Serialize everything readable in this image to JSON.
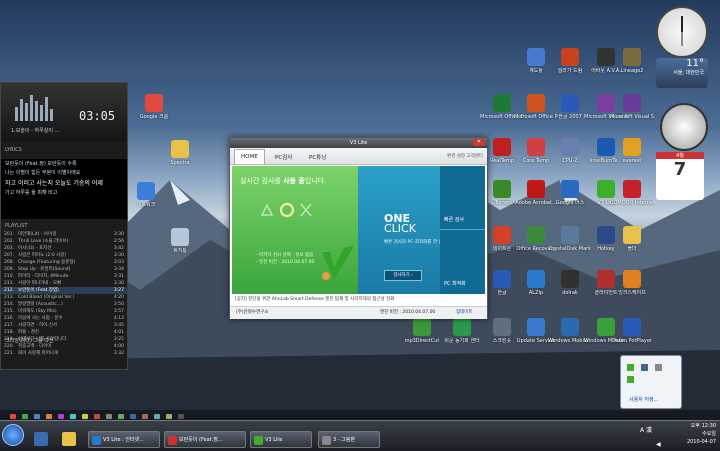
{
  "desktop": {
    "icons_left": [
      {
        "label": "Google 크롬",
        "color": "#e34a3d"
      },
      {
        "label": "Spectra",
        "color": "#e8c14a"
      },
      {
        "label": "네트워크",
        "color": "#3c7fd8"
      },
      {
        "label": "휴지통",
        "color": "#b8c7d8"
      }
    ],
    "icons_grid": [
      {
        "label": "계도툴",
        "color": "#4a7ad0"
      },
      {
        "label": "릴라가 드림",
        "color": "#c7421f"
      },
      {
        "label": "어바웃 A.V.A.",
        "color": "#333333"
      },
      {
        "label": "Lineage2",
        "color": "#7b6c3f"
      },
      {
        "label": "Microsoft Office Ex...",
        "color": "#1f7a3a"
      },
      {
        "label": "Microsoft Office Po...",
        "color": "#d0531d"
      },
      {
        "label": "한글 2007",
        "color": "#2d5ab8"
      },
      {
        "label": "Microsoft Visual Ba...",
        "color": "#7a3fa0"
      },
      {
        "label": "Microsoft Visual Stud...",
        "color": "#6a3a9a"
      },
      {
        "label": "RealTemp",
        "color": "#c02020"
      },
      {
        "label": "Core Temp",
        "color": "#d04040"
      },
      {
        "label": "CPU-Z",
        "color": "#6a7fb0"
      },
      {
        "label": "IntelBurnTe...",
        "color": "#1a5ab0"
      },
      {
        "label": "everest",
        "color": "#e0a020"
      },
      {
        "label": "uTorrent",
        "color": "#3a8a2a"
      },
      {
        "label": "Adobe Acrobat...",
        "color": "#c01818"
      },
      {
        "label": "Google 어스",
        "color": "#2a6ac0"
      },
      {
        "label": "V3 Lite",
        "color": "#3fae2a"
      },
      {
        "label": "COMODO Internet...",
        "color": "#c8202a"
      },
      {
        "label": "네이트온",
        "color": "#d4402a"
      },
      {
        "label": "Office Recovery",
        "color": "#3a8a3a"
      },
      {
        "label": "CrystalDisk Mark",
        "color": "#5a7aa0"
      },
      {
        "label": "Hotkey",
        "color": "#2a4a8a"
      },
      {
        "label": "폴더",
        "color": "#e8c14a"
      },
      {
        "label": "한글",
        "color": "#2a5ab8"
      },
      {
        "label": "ALZip",
        "color": "#2a7ad0"
      },
      {
        "label": "dolrak",
        "color": "#303030"
      },
      {
        "label": "클라이언트",
        "color": "#b03030"
      },
      {
        "label": "잉크스케이프",
        "color": "#e08020"
      },
      {
        "label": "mp3DirectCut",
        "color": "#3a9a3a"
      },
      {
        "label": "쉬운 동기화 센터",
        "color": "#2a9a4a"
      },
      {
        "label": "스크린숏",
        "color": "#607080"
      },
      {
        "label": "Update Service",
        "color": "#3a7ad0"
      },
      {
        "label": "Windows Mobile...",
        "color": "#2a6ab0"
      },
      {
        "label": "Windows Mobile...",
        "color": "#3aa03a"
      },
      {
        "label": "Daum PotPlayer",
        "color": "#2a5ab8"
      }
    ]
  },
  "player": {
    "time": "03:05",
    "title": "1.보슬이 - 하루살이 ...",
    "lyrics_header": "LYRICS",
    "lyrics": [
      "보란듯이 (Feat.정) 보란듯이 수록",
      "나는 이별이 힘든 부분이 이별이에요",
      "자고 이러고 사는지 오늘도 기승의 어제",
      "가고 하루를 울 피해 비고"
    ],
    "playlist_header": "PLAYLIST",
    "playlist": [
      {
        "n": "201.",
        "t": "미안해(Lit) - 브아걸",
        "d": "3:30"
      },
      {
        "n": "202.",
        "t": "Thrill Love (소울 라이브)",
        "d": "2:56"
      },
      {
        "n": "203.",
        "t": "아시나요 - 포지션",
        "d": "3:42"
      },
      {
        "n": "207.",
        "t": "사랑은 피아노 (2:0 사랑)",
        "d": "3:30"
      },
      {
        "n": "208.",
        "t": "Change (Featuring 용준형)",
        "d": "3:03"
      },
      {
        "n": "209.",
        "t": "Step Up - 쥬얼리(Sound)",
        "d": "3:34"
      },
      {
        "n": "210.",
        "t": "파이터 - 다비치, 4Minute",
        "d": "3:31"
      },
      {
        "n": "211.",
        "t": "사랑이 떠나가네 - 오빠",
        "d": "3:30"
      },
      {
        "n": "212.",
        "t": "보란듯이 (Feat.정엽)",
        "d": "3:27"
      },
      {
        "n": "213.",
        "t": "Cold Blood (Original Ver.)",
        "d": "4:20"
      },
      {
        "n": "214.",
        "t": "말랑말랑 (Acoustic...)",
        "d": "3:50"
      },
      {
        "n": "215.",
        "t": "미워해도 (Sky Mix)",
        "d": "3:57"
      },
      {
        "n": "216.",
        "t": "마음에 사는 사람 - 문수",
        "d": "4:12"
      },
      {
        "n": "217.",
        "t": "사랑하면 - 하이 신서",
        "d": "3:45"
      },
      {
        "n": "218.",
        "t": "퍼플 - 경진",
        "d": "4:01"
      },
      {
        "n": "219.",
        "t": "이별보다 나를 사랑합니다",
        "d": "3:25"
      },
      {
        "n": "220.",
        "t": "취중고백 - 다이아",
        "d": "4:00"
      },
      {
        "n": "221.",
        "t": "화이 사랑해 피어나게",
        "d": "3:32"
      }
    ],
    "selected_index": 8,
    "bottom_text": "크라잉넛(다) 그를 다신"
  },
  "v3": {
    "window_title": "V3 Lite",
    "tabs": [
      "HOME",
      "PC검사",
      "PC튜닝"
    ],
    "links": "환경 설정   고객센터",
    "headline_pre": "실시간 검사를 ",
    "headline_bold": "사용 중",
    "headline_post": "입니다.",
    "info_lines": [
      "- 마지막 검사 날짜 : 정보 없음",
      "- 엔진 버전 : 2010.04.07.00"
    ],
    "oneclick_title1": "ONE",
    "oneclick_title2": "CLICK",
    "oneclick_desc": "빠른 검사와 PC 최적화를 한 번에 합니다",
    "oneclick_button": "검사하기 ›",
    "side_button1": "빠른 검사",
    "side_button2": "PC 최적화",
    "news": "[공지] 진단을 위한 AhnLab Smart Defense 엔진 탑재 및 사각지대의 접근성 강화",
    "footer_brand": "(주)안철수연구소",
    "footer_version": "엔진 버전 : 2010.04.07.00",
    "footer_update": "업데이트"
  },
  "gadgets": {
    "weather_temp": "11°",
    "weather_city": "서울, 대한민국",
    "calendar_month": "4월",
    "calendar_day": "7"
  },
  "tray_popup": {
    "customize": "사용자 지정..."
  },
  "taskbar": {
    "buttons": [
      {
        "label": "V3 Lite : 인터넷...",
        "color": "#2a7ad0"
      },
      {
        "label": "보란듯이 (Feat.정...",
        "color": "#d03030"
      },
      {
        "label": "V3 Lite",
        "color": "#3fae2a"
      },
      {
        "label": "3 - 그림판",
        "color": "#888888"
      }
    ],
    "time": "오후 12:30",
    "weekday": "수요일",
    "date": "2010-04-07"
  }
}
